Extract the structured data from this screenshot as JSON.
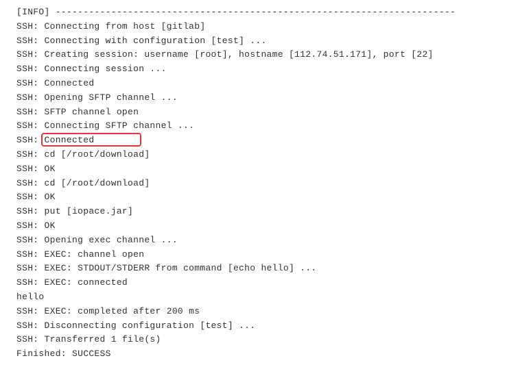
{
  "log": {
    "lines": [
      "[INFO] ------------------------------------------------------------------------",
      "SSH: Connecting from host [gitlab]",
      "SSH: Connecting with configuration [test] ...",
      "SSH: Creating session: username [root], hostname [112.74.51.171], port [22]",
      "SSH: Connecting session ...",
      "SSH: Connected",
      "SSH: Opening SFTP channel ...",
      "SSH: SFTP channel open",
      "SSH: Connecting SFTP channel ...",
      "SSH: Connected",
      "SSH: cd [/root/download]",
      "SSH: OK",
      "SSH: cd [/root/download]",
      "SSH: OK",
      "SSH: put [iopace.jar]",
      "SSH: OK",
      "SSH: Opening exec channel ...",
      "SSH: EXEC: channel open",
      "SSH: EXEC: STDOUT/STDERR from command [echo hello] ...",
      "SSH: EXEC: connected",
      "hello",
      "SSH: EXEC: completed after 200 ms",
      "SSH: Disconnecting configuration [test] ...",
      "SSH: Transferred 1 file(s)",
      "Finished: SUCCESS"
    ]
  },
  "highlight": {
    "targetLineIndex": 10,
    "text": "cd [/root/download]"
  }
}
